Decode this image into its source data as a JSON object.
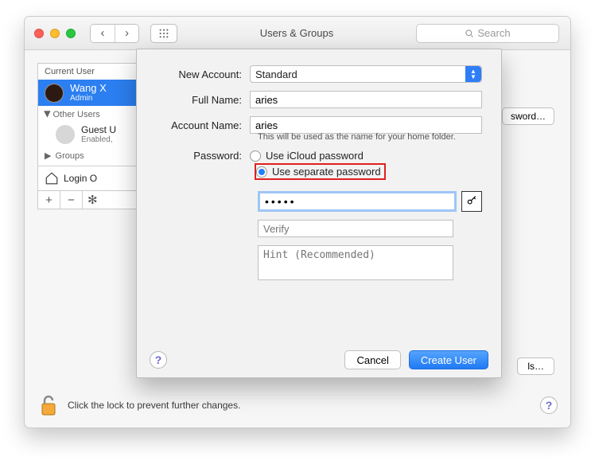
{
  "titlebar": {
    "title": "Users & Groups",
    "search_placeholder": "Search"
  },
  "sidebar": {
    "current_user_header": "Current User",
    "current_user": {
      "name": "Wang X",
      "role": "Admin"
    },
    "other_users_header": "Other Users",
    "guest": {
      "name": "Guest U",
      "status": "Enabled,"
    },
    "groups_header": "Groups",
    "login_options": "Login O"
  },
  "mainpane": {
    "change_password_btn": "sword…",
    "ls_btn": "ls…"
  },
  "footer": {
    "lock_text": "Click the lock to prevent further changes."
  },
  "sheet": {
    "labels": {
      "new_account": "New Account:",
      "full_name": "Full Name:",
      "account_name": "Account Name:",
      "password": "Password:"
    },
    "new_account_value": "Standard",
    "full_name_value": "aries",
    "account_name_value": "aries",
    "account_name_hint": "This will be used as the name for your home folder.",
    "radio_icloud": "Use iCloud password",
    "radio_separate": "Use separate password",
    "password_value": "•••••",
    "verify_placeholder": "Verify",
    "hint_placeholder": "Hint (Recommended)",
    "cancel": "Cancel",
    "create": "Create User"
  }
}
